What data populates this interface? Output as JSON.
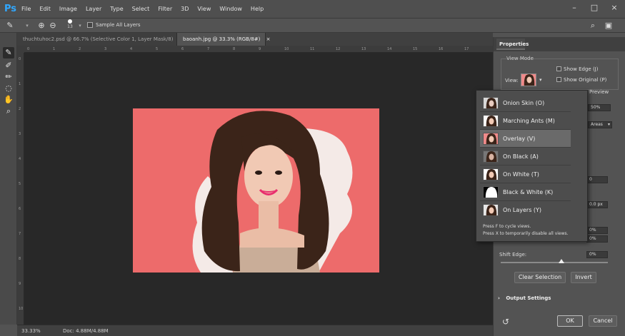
{
  "app": {
    "logo": "Ps"
  },
  "menu": [
    "File",
    "Edit",
    "Image",
    "Layer",
    "Type",
    "Select",
    "Filter",
    "3D",
    "View",
    "Window",
    "Help"
  ],
  "window_controls": {
    "minimize": "–",
    "restore": "□",
    "close": "×"
  },
  "options_bar": {
    "brush_size": "13",
    "sample_all_layers": "Sample All Layers"
  },
  "tabs": [
    {
      "label": "thuchtuhoc2.psd @ 66.7% (Selective Color 1, Layer Mask/8)",
      "close": "×"
    },
    {
      "label": "baoanh.jpg @ 33.3% (RGB/8#)",
      "close": "×"
    }
  ],
  "ruler": {
    "top": [
      "0",
      "1",
      "2",
      "3",
      "4",
      "5",
      "6",
      "7",
      "8",
      "9",
      "10",
      "11",
      "12",
      "13",
      "14",
      "15",
      "16",
      "17"
    ],
    "left": [
      "0",
      "1",
      "2",
      "3",
      "4",
      "5",
      "6",
      "7",
      "8",
      "9",
      "10"
    ]
  },
  "status": {
    "zoom": "33.33%",
    "doc": "Doc: 4.88M/4.88M"
  },
  "properties": {
    "tab": "Properties",
    "view_mode_label": "View Mode",
    "view_label": "View:",
    "show_edge": "Show Edge (J)",
    "show_original": "Show Original (P)",
    "preview": "Preview",
    "field_opacity": "50%",
    "areas": "Areas",
    "field_radius": "0",
    "field_px": "0.0 px",
    "field_pct1": "0%",
    "field_pct2": "0%",
    "shift_edge_label": "Shift Edge:",
    "shift_edge_value": "0%",
    "clear_selection": "Clear Selection",
    "invert": "Invert",
    "output_settings": "Output Settings",
    "ok": "OK",
    "cancel": "Cancel"
  },
  "view_dropdown": {
    "items": [
      {
        "label": "Onion Skin (O)",
        "thumb": "onion"
      },
      {
        "label": "Marching Ants (M)",
        "thumb": "ants"
      },
      {
        "label": "Overlay (V)",
        "thumb": "overlay",
        "selected": true
      },
      {
        "label": "On Black (A)",
        "thumb": "black"
      },
      {
        "label": "On White (T)",
        "thumb": "white"
      },
      {
        "label": "Black & White (K)",
        "thumb": "bw"
      },
      {
        "label": "On Layers (Y)",
        "thumb": "layers"
      }
    ],
    "footer_line1": "Press F to cycle views.",
    "footer_line2": "Press X to temporarily disable all views."
  },
  "colors": {
    "photo_bg": "#ed6b6b",
    "accent": "#31a8ff"
  }
}
